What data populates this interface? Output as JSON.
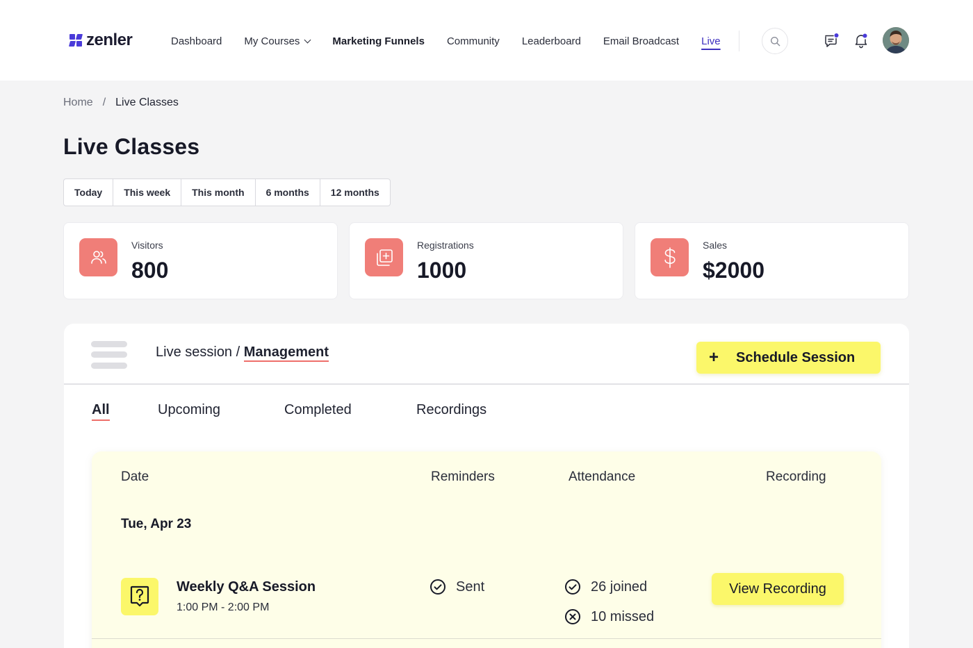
{
  "brand": {
    "name": "zenler",
    "color": "#4a3bd9"
  },
  "nav": {
    "items": [
      {
        "label": "Dashboard",
        "style": "normal"
      },
      {
        "label": "My Courses",
        "style": "dropdown"
      },
      {
        "label": "Marketing Funnels",
        "style": "strong"
      },
      {
        "label": "Community",
        "style": "normal"
      },
      {
        "label": "Leaderboard",
        "style": "normal"
      },
      {
        "label": "Email Broadcast",
        "style": "normal"
      },
      {
        "label": "Live",
        "style": "active"
      }
    ],
    "icons": [
      "search-icon",
      "chat-icon",
      "bell-icon",
      "avatar"
    ]
  },
  "breadcrumb": {
    "home": "Home",
    "separator": "/",
    "current": "Live Classes"
  },
  "page": {
    "title": "Live Classes"
  },
  "filters": [
    "Today",
    "This week",
    "This month",
    "6 months",
    "12 months"
  ],
  "stats": [
    {
      "label": "Visitors",
      "value": "800",
      "icon": "users-icon"
    },
    {
      "label": "Registrations",
      "value": "1000",
      "icon": "add-registration-icon"
    },
    {
      "label": "Sales",
      "value": "$2000",
      "icon": "dollar-icon"
    }
  ],
  "panel": {
    "title_prefix": "Live session /",
    "title_emphasis": "Management",
    "schedule_plus": "+",
    "schedule_label": "Schedule Session",
    "tabs": [
      "All",
      "Upcoming",
      "Completed",
      "Recordings"
    ],
    "active_tab": "All",
    "columns": [
      "Date",
      "Reminders",
      "Attendance",
      "Recording"
    ],
    "date_group": "Tue, Apr 23",
    "session": {
      "name": "Weekly Q&A Session",
      "time": "1:00 PM - 2:00 PM",
      "reminder": "Sent",
      "joined": "26 joined",
      "missed": "10 missed",
      "recording_button": "View Recording"
    }
  },
  "colors": {
    "accent_yellow": "#fbf76a",
    "stat_icon_bg": "#f07e78",
    "underline": "#ee6f6a",
    "table_bg": "#fefee8"
  }
}
